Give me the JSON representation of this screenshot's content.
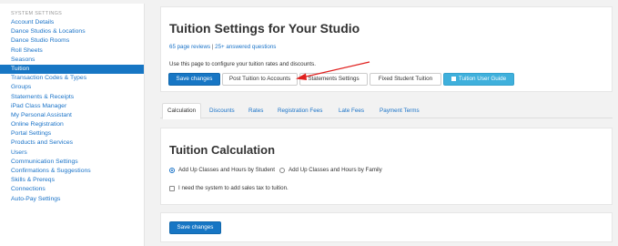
{
  "sidebar": {
    "header": "SYSTEM SETTINGS",
    "items": [
      {
        "label": "Account Details",
        "active": false
      },
      {
        "label": "Dance Studios & Locations",
        "active": false
      },
      {
        "label": "Dance Studio Rooms",
        "active": false
      },
      {
        "label": "Roll Sheets",
        "active": false
      },
      {
        "label": "Seasons",
        "active": false
      },
      {
        "label": "Tuition",
        "active": true
      },
      {
        "label": "Transaction Codes & Types",
        "active": false
      },
      {
        "label": "Groups",
        "active": false
      },
      {
        "label": "Statements & Receipts",
        "active": false
      },
      {
        "label": "iPad Class Manager",
        "active": false
      },
      {
        "label": "My Personal Assistant",
        "active": false
      },
      {
        "label": "Online Registration",
        "active": false
      },
      {
        "label": "Portal Settings",
        "active": false
      },
      {
        "label": "Products and Services",
        "active": false
      },
      {
        "label": "Users",
        "active": false
      },
      {
        "label": "Communication Settings",
        "active": false
      },
      {
        "label": "Confirmations & Suggestions",
        "active": false
      },
      {
        "label": "Skills & Prereqs",
        "active": false
      },
      {
        "label": "Connections",
        "active": false
      },
      {
        "label": "Auto-Pay Settings",
        "active": false
      }
    ]
  },
  "header": {
    "title": "Tuition Settings for Your Studio",
    "reviews_link": "65 page reviews",
    "separator": "|",
    "questions_link": "25+ answered questions",
    "description": "Use this page to configure your tuition rates and discounts."
  },
  "buttons": {
    "save": "Save changes",
    "post_tuition": "Post Tuition to Accounts",
    "statements_settings": "Statements Settings",
    "fixed_student_tuition": "Fixed Student Tuition",
    "user_guide": "Tuition User Guide",
    "user_guide_icon": "book-icon"
  },
  "tabs": [
    {
      "label": "Calculation",
      "active": true
    },
    {
      "label": "Discounts",
      "active": false
    },
    {
      "label": "Rates",
      "active": false
    },
    {
      "label": "Registration Fees",
      "active": false
    },
    {
      "label": "Late Fees",
      "active": false
    },
    {
      "label": "Payment Terms",
      "active": false
    }
  ],
  "calculation": {
    "title": "Tuition Calculation",
    "option_student": "Add Up Classes and Hours by Student",
    "option_family": "Add Up Classes and Hours by Family",
    "selected": "student",
    "sales_tax_label": "I need the system to add sales tax to tuition.",
    "sales_tax_checked": false
  },
  "footer": {
    "save": "Save changes"
  },
  "colors": {
    "primary": "#1776c4",
    "link": "#1a73c8",
    "info": "#3fb0dc",
    "annotation_arrow": "#e0201e"
  }
}
